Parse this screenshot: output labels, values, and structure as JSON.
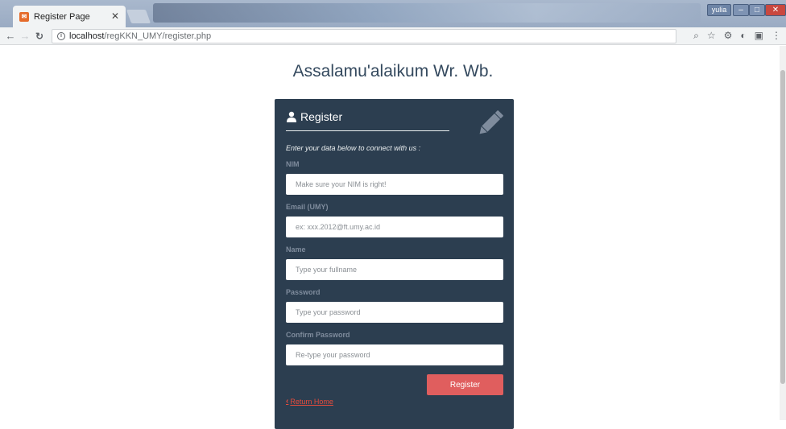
{
  "browser": {
    "tab_title": "Register Page",
    "url_host": "localhost",
    "url_path": "/regKKN_UMY/register.php",
    "window_user": "yulia"
  },
  "page": {
    "greeting": "Assalamu'alaikum Wr. Wb."
  },
  "form": {
    "title": "Register",
    "subtitle": "Enter your data below to connect with us :",
    "fields": [
      {
        "label": "NIM",
        "placeholder": "Make sure your NIM is right!"
      },
      {
        "label": "Email (UMY)",
        "placeholder": "ex: xxx.2012@ft.umy.ac.id"
      },
      {
        "label": "Name",
        "placeholder": "Type your fullname"
      },
      {
        "label": "Password",
        "placeholder": "Type your password"
      },
      {
        "label": "Confirm Password",
        "placeholder": "Re-type your password"
      }
    ],
    "submit_label": "Register",
    "return_label": "Return Home"
  },
  "colors": {
    "card_bg": "#2c3e50",
    "button": "#e05e5e",
    "link": "#e74c3c"
  }
}
